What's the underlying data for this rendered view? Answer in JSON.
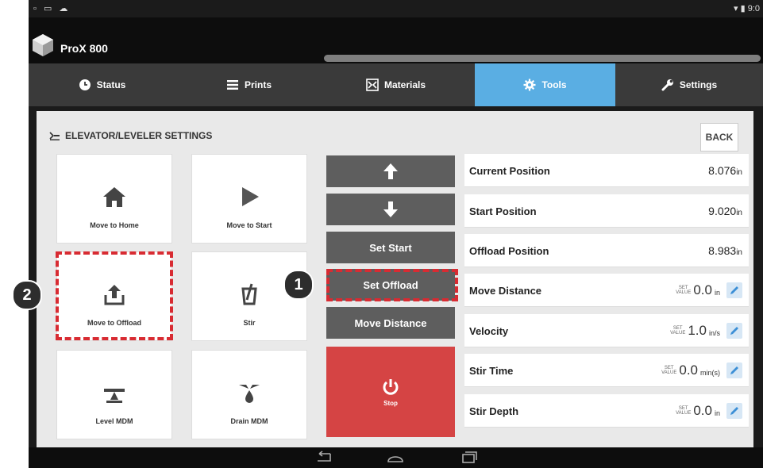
{
  "status_bar": {
    "left_icons": [
      "screenshot-icon",
      "gallery-icon",
      "app-icon"
    ],
    "time": "9:0"
  },
  "app": {
    "title": "ProX 800"
  },
  "tabs": [
    {
      "label": "Status",
      "icon": "clock-icon"
    },
    {
      "label": "Prints",
      "icon": "list-icon"
    },
    {
      "label": "Materials",
      "icon": "materials-icon"
    },
    {
      "label": "Tools",
      "icon": "gear-icon",
      "active": true
    },
    {
      "label": "Settings",
      "icon": "wrench-icon"
    }
  ],
  "panel": {
    "title": "ELEVATOR/LEVELER SETTINGS",
    "back_label": "BACK"
  },
  "tiles": [
    {
      "label": "Move to Home",
      "icon": "home-icon"
    },
    {
      "label": "Move to Start",
      "icon": "play-icon"
    },
    {
      "label": "Move to Offload",
      "icon": "upload-icon"
    },
    {
      "label": "Stir",
      "icon": "stir-icon"
    },
    {
      "label": "Level MDM",
      "icon": "level-icon"
    },
    {
      "label": "Drain MDM",
      "icon": "drain-icon"
    }
  ],
  "controls": {
    "up": "arrow-up-icon",
    "down": "arrow-down-icon",
    "set_start": "Set Start",
    "set_offload": "Set Offload",
    "move_distance": "Move Distance",
    "stop": "Stop"
  },
  "readouts": [
    {
      "label": "Current Position",
      "value": "8.076",
      "unit": "in"
    },
    {
      "label": "Start Position",
      "value": "9.020",
      "unit": "in"
    },
    {
      "label": "Offload Position",
      "value": "8.983",
      "unit": "in"
    }
  ],
  "set_label": {
    "line1": "SET",
    "line2": "VALUE"
  },
  "settings": [
    {
      "label": "Move Distance",
      "value": "0.0",
      "unit": "in"
    },
    {
      "label": "Velocity",
      "value": "1.0",
      "unit": "in/s"
    },
    {
      "label": "Stir Time",
      "value": "0.0",
      "unit": "min(s)"
    },
    {
      "label": "Stir Depth",
      "value": "0.0",
      "unit": "in"
    }
  ],
  "callouts": {
    "one": "1",
    "two": "2"
  },
  "colors": {
    "tab_active": "#5aaee3",
    "stop": "#d54444",
    "callout": "#d82b32",
    "button": "#5e5e5e"
  }
}
